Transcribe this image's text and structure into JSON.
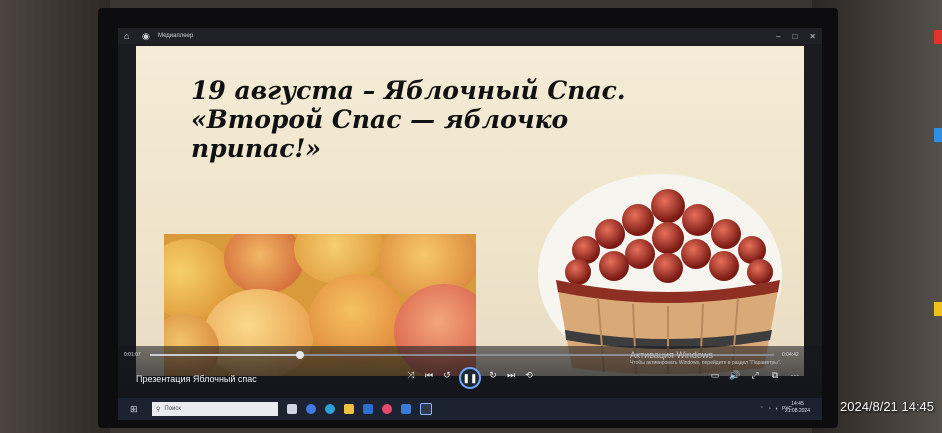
{
  "window": {
    "app_title": "Медиаплеер",
    "home_icon": "home-icon",
    "app_icon": "media-player-icon",
    "controls": {
      "minimize": "–",
      "maximize": "□",
      "close": "✕"
    }
  },
  "slide": {
    "title_lines": [
      "19 августа – Яблочный Спас.",
      "«Второй Спас — яблочко",
      "припас!»"
    ]
  },
  "player": {
    "elapsed": "0:01:07",
    "duration": "0:04:42",
    "progress_fraction": 0.24,
    "media_title": "Презентация Яблочный спас",
    "buttons": {
      "shuffle": "⤨",
      "previous": "⏮",
      "rewind": "↺",
      "pause": "❚❚",
      "forward": "↻",
      "next": "⏭",
      "repeat": "⟲",
      "subtitles": "▭",
      "volume": "🔊",
      "fullscreen": "⤢",
      "miniplayer": "⧉",
      "more": "···"
    }
  },
  "activation": {
    "heading": "Активация Windows",
    "text": "Чтобы активировать Windows, перейдите в раздел \"Параметры\"."
  },
  "taskbar": {
    "search_placeholder": "Поиск",
    "language": "РУС",
    "time": "14:45",
    "date": "21.08.2024",
    "notification_count": "1"
  },
  "camera_timestamp": "2024/8/21 14:45",
  "colors": {
    "accent": "#6fa8ff",
    "taskbar": "#1d2230",
    "slide_background": "#f2e8d0"
  }
}
